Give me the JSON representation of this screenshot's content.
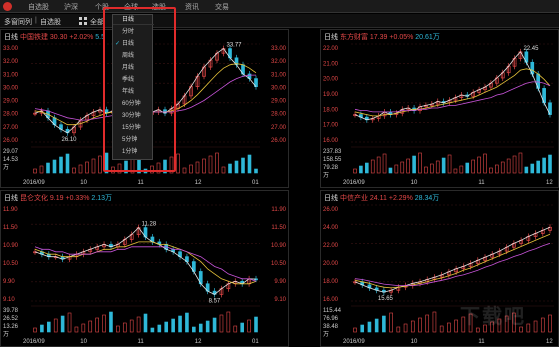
{
  "topbar": {
    "items": [
      "自选股",
      "沪深",
      "个股",
      "全球",
      "选股",
      "资讯",
      "交易"
    ]
  },
  "subbar": {
    "left": "多窗同列",
    "right": "自选股",
    "tab": "全部"
  },
  "dropdown": {
    "header": "日线",
    "items": [
      "分时",
      "日线",
      "周线",
      "月线",
      "季线",
      "年线",
      "60分钟",
      "30分钟",
      "15分钟",
      "5分钟",
      "1分钟"
    ],
    "checked_index": 1
  },
  "panels": [
    {
      "name": "中国铁建",
      "period": "日线",
      "price": "30.30",
      "change": "+2.02%",
      "extra": "5.5",
      "y_labels": [
        "33.00",
        "32.00",
        "31.00",
        "30.00",
        "29.00",
        "28.00",
        "27.00",
        "26.00"
      ],
      "hi_label": "33.77",
      "lo_label": "26.10",
      "vol_labels": [
        "29.07",
        "14.53",
        "万"
      ],
      "x_labels": [
        "2016/09",
        "10",
        "11",
        "12",
        "01"
      ],
      "chart_data": {
        "type": "line",
        "ylim": [
          25.5,
          34
        ],
        "series": [
          {
            "values": [
              28.0,
              28.2,
              27.6,
              27.0,
              26.6,
              26.3,
              26.8,
              27.4,
              27.8,
              28.1,
              28.3,
              28.0,
              28.2,
              28.5,
              28.4,
              28.6,
              28.2,
              27.9,
              28.1,
              28.3,
              28.0,
              28.4,
              28.8,
              29.5,
              30.3,
              31.2,
              32.0,
              32.6,
              33.2,
              33.6,
              32.8,
              32.2,
              31.4,
              31.0,
              30.3
            ]
          },
          {
            "values": [
              28.2,
              28.1,
              27.9,
              27.6,
              27.3,
              27.0,
              27.0,
              27.1,
              27.3,
              27.6,
              27.8,
              28.0,
              28.1,
              28.2,
              28.3,
              28.4,
              28.3,
              28.2,
              28.1,
              28.1,
              28.1,
              28.2,
              28.4,
              28.7,
              29.1,
              29.6,
              30.2,
              30.8,
              31.4,
              31.9,
              32.2,
              32.3,
              32.2,
              31.9,
              31.5
            ]
          },
          {
            "values": [
              28.4,
              28.3,
              28.2,
              28.0,
              27.8,
              27.6,
              27.5,
              27.4,
              27.4,
              27.5,
              27.6,
              27.7,
              27.8,
              27.9,
              28.0,
              28.1,
              28.1,
              28.1,
              28.1,
              28.1,
              28.1,
              28.1,
              28.2,
              28.3,
              28.5,
              28.8,
              29.1,
              29.5,
              29.9,
              30.3,
              30.7,
              31.0,
              31.2,
              31.3,
              31.3
            ]
          }
        ]
      }
    },
    {
      "name": "东方财富",
      "period": "日线",
      "price": "17.39",
      "change": "+0.05%",
      "extra": "20.61万",
      "y_labels": [
        "22.00",
        "21.00",
        "20.00",
        "19.00",
        "18.00",
        "17.00",
        "16.00"
      ],
      "hi_label": "22.45",
      "lo_label": "",
      "vol_labels": [
        "237.83",
        "158.55",
        "79.28",
        "万"
      ],
      "x_labels": [
        "2016/09",
        "10",
        "11",
        "12"
      ],
      "chart_data": {
        "type": "line",
        "ylim": [
          15.5,
          23
        ],
        "series": [
          {
            "values": [
              17.6,
              17.4,
              17.2,
              17.3,
              17.5,
              17.8,
              17.6,
              17.7,
              18.0,
              18.1,
              17.9,
              18.2,
              18.3,
              18.4,
              18.6,
              18.5,
              18.7,
              18.9,
              19.1,
              19.0,
              19.3,
              19.5,
              19.7,
              20.0,
              20.4,
              20.8,
              21.3,
              21.9,
              22.4,
              21.6,
              20.7,
              19.6,
              18.5,
              17.6
            ]
          },
          {
            "values": [
              17.8,
              17.7,
              17.6,
              17.5,
              17.5,
              17.6,
              17.6,
              17.7,
              17.8,
              17.9,
              18.0,
              18.0,
              18.1,
              18.2,
              18.3,
              18.4,
              18.5,
              18.6,
              18.7,
              18.8,
              18.9,
              19.1,
              19.3,
              19.5,
              19.7,
              20.0,
              20.3,
              20.6,
              21.0,
              21.1,
              21.0,
              20.7,
              20.3,
              19.8
            ]
          },
          {
            "values": [
              18.0,
              17.9,
              17.9,
              17.8,
              17.8,
              17.8,
              17.8,
              17.8,
              17.9,
              17.9,
              17.9,
              18.0,
              18.0,
              18.1,
              18.1,
              18.2,
              18.3,
              18.3,
              18.4,
              18.5,
              18.6,
              18.7,
              18.8,
              18.9,
              19.1,
              19.2,
              19.4,
              19.6,
              19.8,
              20.0,
              20.1,
              20.1,
              20.0,
              19.8
            ]
          }
        ]
      }
    },
    {
      "name": "昆仑文化",
      "period": "日线",
      "price": "9.19",
      "change": "+0.33%",
      "extra": "2.13万",
      "y_labels": [
        "11.90",
        "11.50",
        "10.90",
        "10.50",
        "9.90",
        "9.10"
      ],
      "hi_label": "11.28",
      "lo_label": "8.57",
      "vol_labels": [
        "39.78",
        "26.52",
        "13.26",
        "万"
      ],
      "x_labels": [
        "2016/09",
        "10",
        "11",
        "12",
        "01"
      ],
      "chart_data": {
        "type": "line",
        "ylim": [
          8.3,
          12.2
        ],
        "series": [
          {
            "values": [
              10.3,
              10.2,
              10.1,
              10.1,
              10.0,
              10.1,
              10.2,
              10.3,
              10.4,
              10.5,
              10.6,
              10.5,
              10.6,
              10.8,
              11.0,
              11.28,
              10.9,
              10.7,
              10.6,
              10.4,
              10.3,
              10.1,
              9.9,
              9.5,
              9.0,
              8.7,
              8.57,
              8.8,
              9.0,
              9.1,
              9.0,
              9.2,
              9.19
            ]
          },
          {
            "values": [
              10.4,
              10.3,
              10.2,
              10.2,
              10.1,
              10.1,
              10.1,
              10.2,
              10.2,
              10.3,
              10.4,
              10.4,
              10.5,
              10.5,
              10.6,
              10.7,
              10.7,
              10.7,
              10.6,
              10.6,
              10.5,
              10.4,
              10.3,
              10.1,
              9.9,
              9.6,
              9.4,
              9.2,
              9.1,
              9.0,
              9.0,
              9.0,
              9.1
            ]
          },
          {
            "values": [
              10.5,
              10.4,
              10.4,
              10.3,
              10.3,
              10.2,
              10.2,
              10.2,
              10.2,
              10.3,
              10.3,
              10.3,
              10.4,
              10.4,
              10.5,
              10.5,
              10.5,
              10.5,
              10.5,
              10.5,
              10.4,
              10.4,
              10.3,
              10.2,
              10.1,
              9.9,
              9.7,
              9.6,
              9.4,
              9.3,
              9.2,
              9.2,
              9.1
            ]
          }
        ]
      }
    },
    {
      "name": "中信产业",
      "period": "日线",
      "price": "24.11",
      "change": "+2.29%",
      "extra": "28.34万",
      "y_labels": [
        "26.00",
        "24.00",
        "22.00",
        "20.00",
        "18.00",
        "16.00"
      ],
      "hi_label": "",
      "lo_label": "15.65",
      "vol_labels": [
        "115.44",
        "76.96",
        "38.48",
        "万"
      ],
      "x_labels": [
        "2016/09",
        "10",
        "11",
        "12"
      ],
      "chart_data": {
        "type": "line",
        "ylim": [
          14.5,
          27
        ],
        "series": [
          {
            "values": [
              17.0,
              16.6,
              16.2,
              15.9,
              15.65,
              15.9,
              16.3,
              16.5,
              16.8,
              17.0,
              17.3,
              17.6,
              17.9,
              18.3,
              18.7,
              19.0,
              19.4,
              19.8,
              20.2,
              20.6,
              21.0,
              21.5,
              22.0,
              22.4,
              22.9,
              23.3,
              23.7,
              24.1
            ]
          },
          {
            "values": [
              17.2,
              17.0,
              16.8,
              16.5,
              16.3,
              16.2,
              16.3,
              16.4,
              16.6,
              16.8,
              17.0,
              17.3,
              17.5,
              17.8,
              18.1,
              18.5,
              18.8,
              19.2,
              19.6,
              20.0,
              20.4,
              20.8,
              21.2,
              21.6,
              22.0,
              22.4,
              22.8,
              23.2
            ]
          },
          {
            "values": [
              17.4,
              17.3,
              17.1,
              16.9,
              16.7,
              16.6,
              16.5,
              16.5,
              16.5,
              16.6,
              16.8,
              17.0,
              17.2,
              17.4,
              17.7,
              17.9,
              18.2,
              18.5,
              18.9,
              19.2,
              19.6,
              19.9,
              20.3,
              20.6,
              21.0,
              21.3,
              21.7,
              22.0
            ]
          }
        ]
      }
    }
  ],
  "watermark": "下载吧",
  "colors": {
    "up": "#e34848",
    "down": "#2dbf64",
    "ma1": "#e6e6e6",
    "ma2": "#e7c43a",
    "ma3": "#c653d8",
    "cyan": "#2fb8d8"
  }
}
